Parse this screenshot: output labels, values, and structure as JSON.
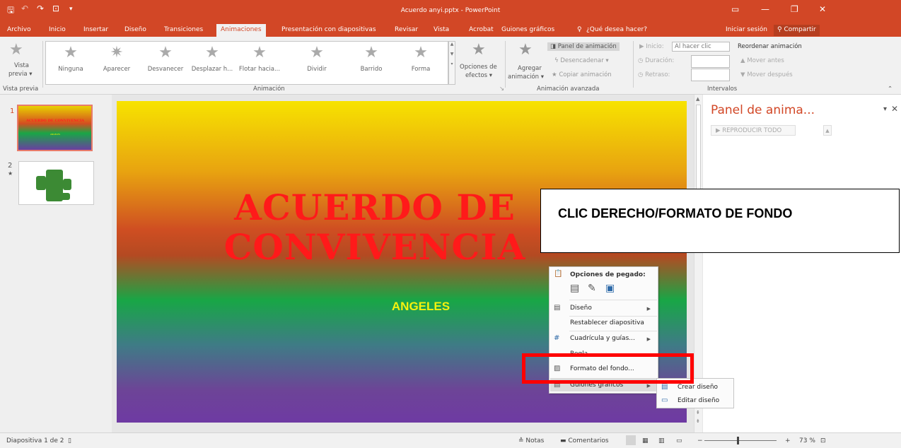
{
  "titlebar": {
    "doc_title": "Acuerdo anyi.pptx - PowerPoint",
    "qa_save": "🖫",
    "qa_undo": "↶",
    "qa_redo": "↷",
    "qa_present": "⊡",
    "qa_more": "▾",
    "win_restore_box": "▭",
    "win_min": "—",
    "win_max": "❐",
    "win_close": "✕"
  },
  "tabs": {
    "archivo": "Archivo",
    "inicio": "Inicio",
    "insertar": "Insertar",
    "diseno": "Diseño",
    "transiciones": "Transiciones",
    "animaciones": "Animaciones",
    "presentacion": "Presentación con diapositivas",
    "revisar": "Revisar",
    "vista": "Vista",
    "acrobat": "Acrobat",
    "guiones": "Guiones gráficos",
    "tell_me": "¿Qué desea hacer?",
    "signin": "Iniciar sesión",
    "share": "Compartir"
  },
  "ribbon": {
    "preview_label": "Vista",
    "preview_label2": "previa ▾",
    "group_preview": "Vista previa",
    "gallery": [
      "Ninguna",
      "Aparecer",
      "Desvanecer",
      "Desplazar h...",
      "Flotar hacia...",
      "Dividir",
      "Barrido",
      "Forma"
    ],
    "effects_label": "Opciones de",
    "effects_label2": "efectos ▾",
    "group_animation": "Animación",
    "add_anim": "Agregar",
    "add_anim2": "animación ▾",
    "anim_pane": "Panel de animación",
    "trigger": "Desencadenar ▾",
    "copy_anim": "Copiar animación",
    "group_advanced": "Animación avanzada",
    "start_label": "Inicio:",
    "start_value": "Al hacer clic",
    "duration_label": "Duración:",
    "delay_label": "Retraso:",
    "reorder": "Reordenar animación",
    "move_earlier": "▲ Mover antes",
    "move_later": "▼ Mover después",
    "group_timing": "Intervalos"
  },
  "thumbs": {
    "num1": "1",
    "num2": "2",
    "star2": "★",
    "t1_title": "ACUERDO DE CONVIVENCIA",
    "t1_sub": "ANGELES"
  },
  "slide": {
    "title_line1": "ACUERDO DE",
    "title_line2": "CONVIVENCIA",
    "subtitle": "ANGELES"
  },
  "panel": {
    "title": "Panel de anima...",
    "play_all": "REPRODUCIR TODO"
  },
  "callout": {
    "text": "CLIC DERECHO/FORMATO DE FONDO"
  },
  "context_menu": {
    "paste_header": "Opciones de pegado:",
    "diseno": "Diseño",
    "restablecer": "Restablecer diapositiva",
    "cuadricula": "Cuadrícula y guías...",
    "regla": "Regla",
    "formato_fondo": "Formato del fondo...",
    "guiones": "Guiones gráficos"
  },
  "submenu": {
    "crear": "Crear diseño",
    "editar": "Editar diseño"
  },
  "status": {
    "slide_of": "Diapositiva 1 de 2",
    "notas": "≙ Notas",
    "comentarios": "Comentarios",
    "zoom": "73 %"
  }
}
